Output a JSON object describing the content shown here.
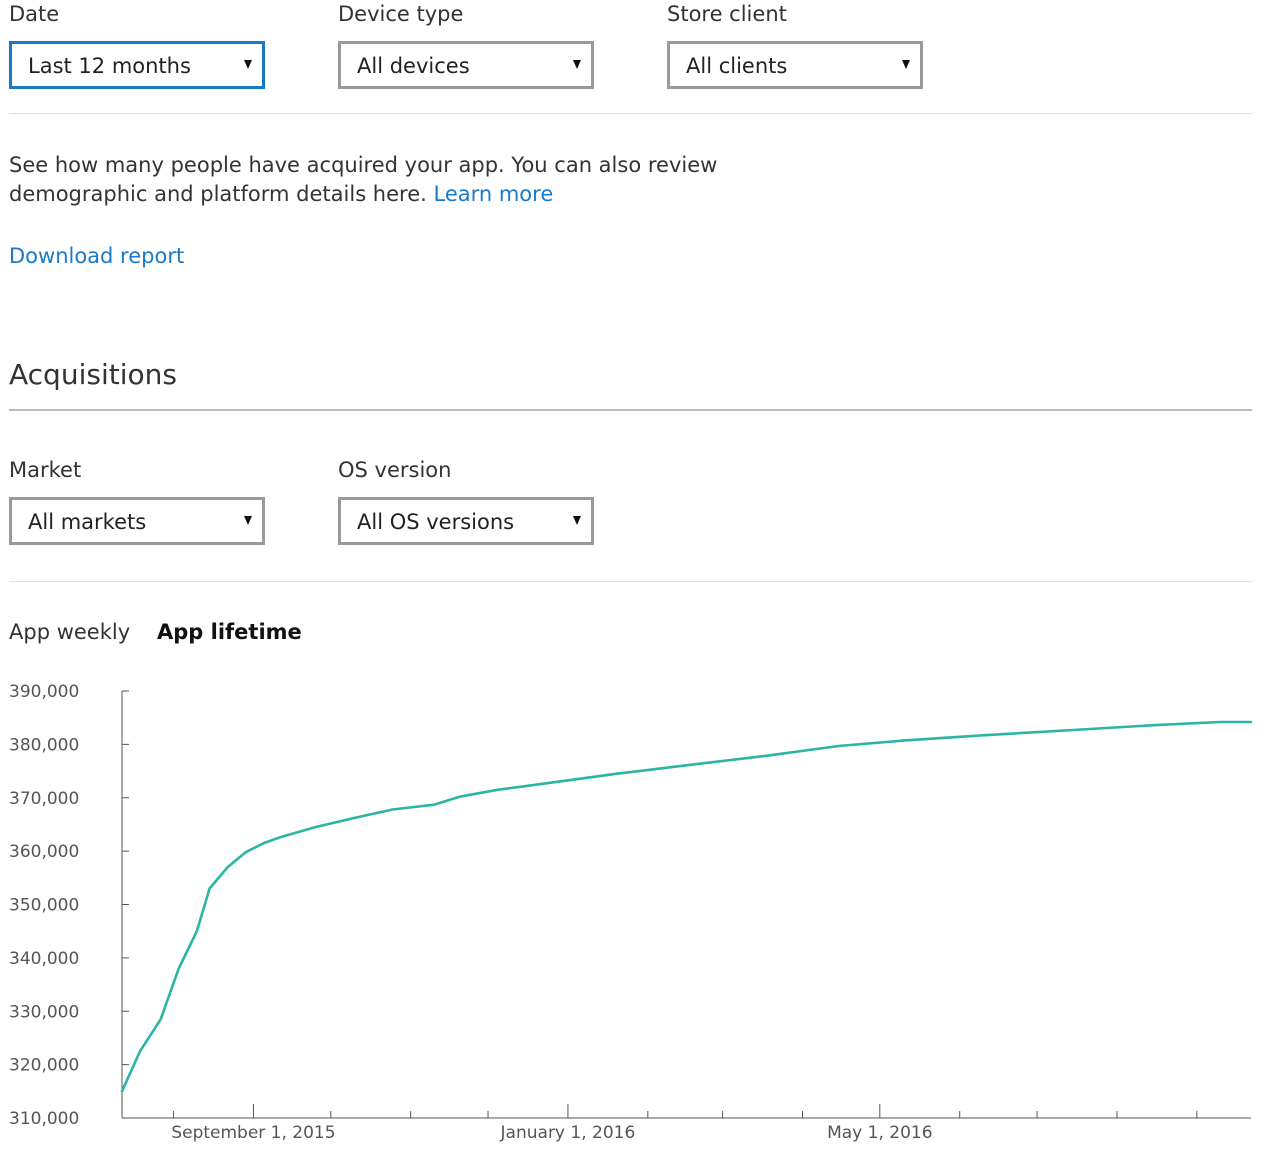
{
  "filters": {
    "date": {
      "label": "Date",
      "value": "Last 12 months"
    },
    "device": {
      "label": "Device type",
      "value": "All devices"
    },
    "store": {
      "label": "Store client",
      "value": "All clients"
    }
  },
  "description": {
    "text": "See how many people have acquired your app. You can also review demographic and platform details here. ",
    "learn_more": "Learn more"
  },
  "download_report": "Download report",
  "section": {
    "title": "Acquisitions",
    "market": {
      "label": "Market",
      "value": "All markets"
    },
    "os": {
      "label": "OS version",
      "value": "All OS versions"
    }
  },
  "tabs": {
    "weekly": "App weekly",
    "lifetime": "App lifetime",
    "active": "lifetime"
  },
  "colors": {
    "accent": "#1b79c9",
    "series": "#2bb5a5"
  },
  "chart_data": {
    "type": "line",
    "y_ticks": [
      "390,000",
      "380,000",
      "370,000",
      "360,000",
      "350,000",
      "340,000",
      "330,000",
      "320,000",
      "310,000"
    ],
    "x_labels": [
      "September 1, 2015",
      "January 1, 2016",
      "May 1, 2016"
    ],
    "ylim": [
      310000,
      390000
    ],
    "grid": false,
    "series": [
      {
        "color": "#2bb5a5",
        "points": [
          [
            "2015-07-12",
            315000
          ],
          [
            "2015-07-19",
            322500
          ],
          [
            "2015-07-27",
            328500
          ],
          [
            "2015-08-03",
            338000
          ],
          [
            "2015-08-10",
            345000
          ],
          [
            "2015-08-15",
            353000
          ],
          [
            "2015-08-22",
            357000
          ],
          [
            "2015-08-29",
            359800
          ],
          [
            "2015-09-05",
            361500
          ],
          [
            "2015-09-12",
            362700
          ],
          [
            "2015-09-25",
            364500
          ],
          [
            "2015-10-10",
            366200
          ],
          [
            "2015-10-25",
            367800
          ],
          [
            "2015-11-10",
            368700
          ],
          [
            "2015-11-20",
            370200
          ],
          [
            "2015-12-05",
            371500
          ],
          [
            "2015-12-25",
            372800
          ],
          [
            "2016-01-20",
            374500
          ],
          [
            "2016-02-20",
            376300
          ],
          [
            "2016-03-20",
            378000
          ],
          [
            "2016-04-15",
            379700
          ],
          [
            "2016-05-10",
            380700
          ],
          [
            "2016-06-10",
            381700
          ],
          [
            "2016-07-15",
            382700
          ],
          [
            "2016-08-15",
            383600
          ],
          [
            "2016-09-10",
            384200
          ],
          [
            "2016-09-22",
            384200
          ]
        ]
      }
    ]
  }
}
